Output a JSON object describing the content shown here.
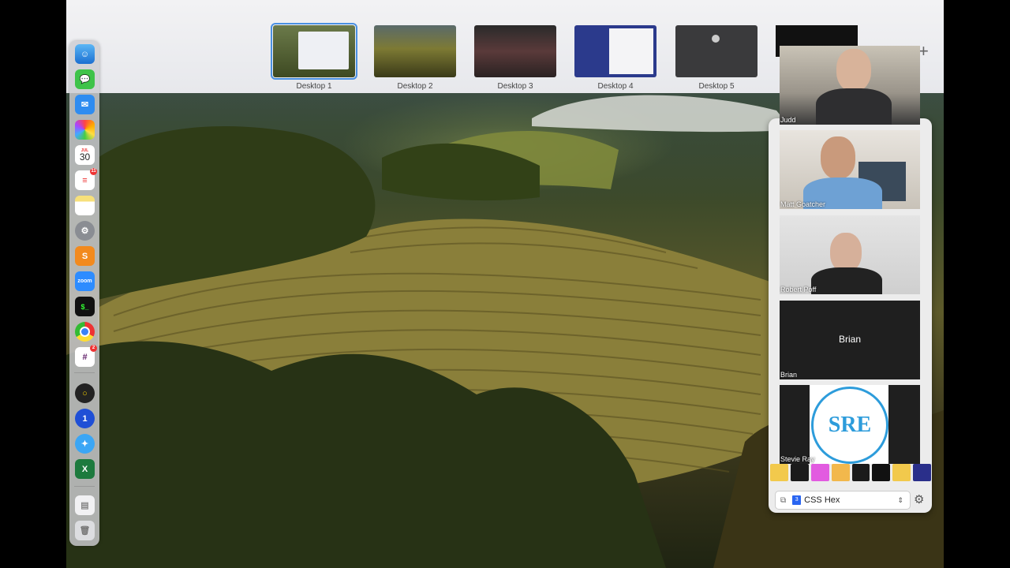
{
  "spaces": [
    {
      "label": "Desktop 1",
      "active": true
    },
    {
      "label": "Desktop 2",
      "active": false
    },
    {
      "label": "Desktop 3",
      "active": false
    },
    {
      "label": "Desktop 4",
      "active": false
    },
    {
      "label": "Desktop 5",
      "active": false
    }
  ],
  "dock": {
    "calendar_day": "30",
    "calendar_month": "JUL",
    "zoom_label": "zoom",
    "reminders_badge": "11",
    "slack_badge": "2"
  },
  "participants": [
    {
      "name": "Judd"
    },
    {
      "name": "Matt Goatcher"
    },
    {
      "name": "Robert Poff"
    },
    {
      "name": "Brian",
      "center_label": "Brian"
    },
    {
      "name": "Stevie Ray",
      "logo_text": "SRE"
    }
  ],
  "color_picker": {
    "format": "CSS Hex",
    "swatches": [
      "#f2c94c",
      "#1b1b1b",
      "#e25be0",
      "#f2b84c",
      "#1b1b1b",
      "#111111",
      "#f2c94c",
      "#2a2f8a"
    ],
    "accent": "#4a90e2"
  }
}
